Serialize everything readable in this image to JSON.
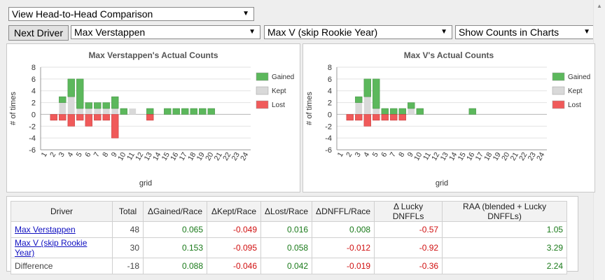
{
  "view_select": {
    "value": "View Head-to-Head Comparison"
  },
  "next_driver_label": "Next Driver",
  "driver1_select": {
    "value": "Max Verstappen"
  },
  "driver2_select": {
    "value": "Max V (skip Rookie Year)"
  },
  "counts_select": {
    "value": "Show Counts in Charts"
  },
  "chart_data": [
    {
      "type": "bar",
      "title": "Max Verstappen's Actual Counts",
      "xlabel": "grid",
      "ylabel": "# of times",
      "ylim": [
        -6,
        8
      ],
      "yticks": [
        -6,
        -4,
        -2,
        0,
        2,
        4,
        6,
        8
      ],
      "categories": [
        "1",
        "2",
        "3",
        "4",
        "5",
        "6",
        "7",
        "8",
        "9",
        "10",
        "11",
        "12",
        "13",
        "14",
        "15",
        "16",
        "17",
        "18",
        "19",
        "20",
        "21",
        "22",
        "23",
        "24"
      ],
      "legend_position": "right",
      "series": [
        {
          "name": "Gained",
          "color": "#5cb85c",
          "values": [
            0,
            0,
            1,
            3,
            5,
            1,
            1,
            1,
            2,
            1,
            0,
            0,
            1,
            0,
            1,
            1,
            1,
            1,
            1,
            1,
            0,
            0,
            0,
            0
          ]
        },
        {
          "name": "Kept",
          "color": "#d9d9d9",
          "values": [
            0,
            0,
            2,
            3,
            1,
            1,
            1,
            1,
            1,
            0,
            1,
            0,
            0,
            0,
            0,
            0,
            0,
            0,
            0,
            0,
            0,
            0,
            0,
            0
          ]
        },
        {
          "name": "Lost",
          "color": "#f05a5a",
          "values": [
            0,
            -1,
            -1,
            -2,
            -1,
            -2,
            -1,
            -1,
            -4,
            0,
            0,
            0,
            -1,
            0,
            0,
            0,
            0,
            0,
            0,
            0,
            0,
            0,
            0,
            0
          ]
        }
      ]
    },
    {
      "type": "bar",
      "title": "Max V's Actual Counts",
      "xlabel": "grid",
      "ylabel": "# of times",
      "ylim": [
        -6,
        8
      ],
      "yticks": [
        -6,
        -4,
        -2,
        0,
        2,
        4,
        6,
        8
      ],
      "categories": [
        "1",
        "2",
        "3",
        "4",
        "5",
        "6",
        "7",
        "8",
        "9",
        "10",
        "11",
        "12",
        "13",
        "14",
        "15",
        "16",
        "17",
        "18",
        "19",
        "20",
        "21",
        "22",
        "23",
        "24"
      ],
      "legend_position": "right",
      "series": [
        {
          "name": "Gained",
          "color": "#5cb85c",
          "values": [
            0,
            0,
            1,
            3,
            5,
            1,
            1,
            1,
            1,
            1,
            0,
            0,
            0,
            0,
            0,
            1,
            0,
            0,
            0,
            0,
            0,
            0,
            0,
            0
          ]
        },
        {
          "name": "Kept",
          "color": "#d9d9d9",
          "values": [
            0,
            0,
            2,
            3,
            1,
            0,
            0,
            0,
            1,
            0,
            0,
            0,
            0,
            0,
            0,
            0,
            0,
            0,
            0,
            0,
            0,
            0,
            0,
            0
          ]
        },
        {
          "name": "Lost",
          "color": "#f05a5a",
          "values": [
            0,
            -1,
            -1,
            -2,
            -1,
            -1,
            -1,
            -1,
            0,
            0,
            0,
            0,
            0,
            0,
            0,
            0,
            0,
            0,
            0,
            0,
            0,
            0,
            0,
            0
          ]
        }
      ]
    }
  ],
  "table": {
    "headers": [
      "Driver",
      "Total",
      "ΔGained/Race",
      "ΔKept/Race",
      "ΔLost/Race",
      "ΔDNFFL/Race",
      "Δ Lucky DNFFLs",
      "RAA (blended + Lucky DNFFLs)"
    ],
    "rows": [
      {
        "driver": "Max Verstappen",
        "link": true,
        "cells": [
          "48",
          "0.065",
          "-0.049",
          "0.016",
          "0.008",
          "-0.57",
          "1.05"
        ]
      },
      {
        "driver": "Max V (skip Rookie Year)",
        "link": true,
        "cells": [
          "30",
          "0.153",
          "-0.095",
          "0.058",
          "-0.012",
          "-0.92",
          "3.29"
        ]
      },
      {
        "driver": "Difference",
        "link": false,
        "cells": [
          "-18",
          "0.088",
          "-0.046",
          "0.042",
          "-0.019",
          "-0.36",
          "2.24"
        ]
      }
    ]
  }
}
